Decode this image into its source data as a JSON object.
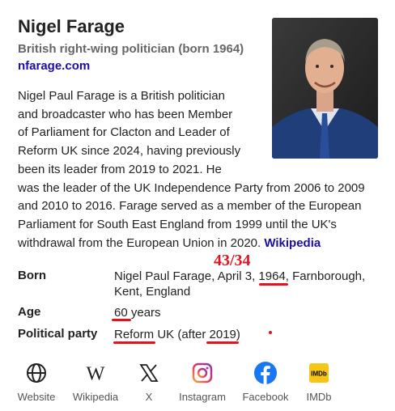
{
  "header": {
    "title": "Nigel Farage",
    "subtitle": "British right-wing politician (born 1964)",
    "website": "nfarage.com"
  },
  "description": {
    "text": "Nigel Paul Farage is a British politician and broadcaster who has been Member of Parliament for Clacton and Leader of Reform UK since 2024, having previously been its leader from 2019 to 2021. He was the leader of the UK Independence Party from 2006 to 2009 and 2010 to 2016. Farage served as a member of the European Parliament for South East England from 1999 until the UK's withdrawal from the European Union in 2020.",
    "source_link": "Wikipedia"
  },
  "facts": {
    "born_label": "Born",
    "born_value": "Nigel Paul Farage, April 3, 1964, Farnborough, Kent, England",
    "age_label": "Age",
    "age_value": "60 years",
    "party_label": "Political party",
    "party_value": "Reform UK (after 2019)"
  },
  "annotation": {
    "score": "43/34",
    "color": "#e0141e"
  },
  "links": [
    {
      "label": "Website",
      "icon": "globe-icon"
    },
    {
      "label": "Wikipedia",
      "icon": "wikipedia-icon"
    },
    {
      "label": "X",
      "icon": "x-icon"
    },
    {
      "label": "Instagram",
      "icon": "instagram-icon"
    },
    {
      "label": "Facebook",
      "icon": "facebook-icon"
    },
    {
      "label": "IMDb",
      "icon": "imdb-icon"
    }
  ]
}
